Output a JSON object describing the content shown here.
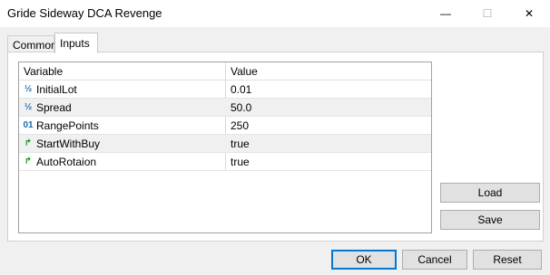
{
  "window": {
    "title": "Gride Sideway DCA Revenge",
    "minimize_glyph": "—",
    "maximize_glyph": "☐",
    "close_glyph": "✕"
  },
  "tabs": [
    {
      "label": "Common",
      "active": false
    },
    {
      "label": "Inputs",
      "active": true
    }
  ],
  "grid": {
    "columns": [
      "Variable",
      "Value"
    ],
    "rows": [
      {
        "icon": "half-fraction-icon",
        "glyph": "½",
        "name": "InitialLot",
        "value": "0.01"
      },
      {
        "icon": "half-fraction-icon",
        "glyph": "½",
        "name": "Spread",
        "value": "50.0"
      },
      {
        "icon": "integer-icon",
        "glyph": "01",
        "name": "RangePoints",
        "value": "250"
      },
      {
        "icon": "boolean-icon",
        "glyph": "↱",
        "name": "StartWithBuy",
        "value": "true"
      },
      {
        "icon": "boolean-icon",
        "glyph": "↱",
        "name": "AutoRotaion",
        "value": "true"
      }
    ]
  },
  "side_buttons": {
    "load": "Load",
    "save": "Save"
  },
  "footer_buttons": {
    "ok": "OK",
    "cancel": "Cancel",
    "reset": "Reset"
  },
  "colors": {
    "accent": "#0078d7",
    "numeric_icon": "#1a6bb0",
    "boolean_icon": "#1a9a2a"
  }
}
